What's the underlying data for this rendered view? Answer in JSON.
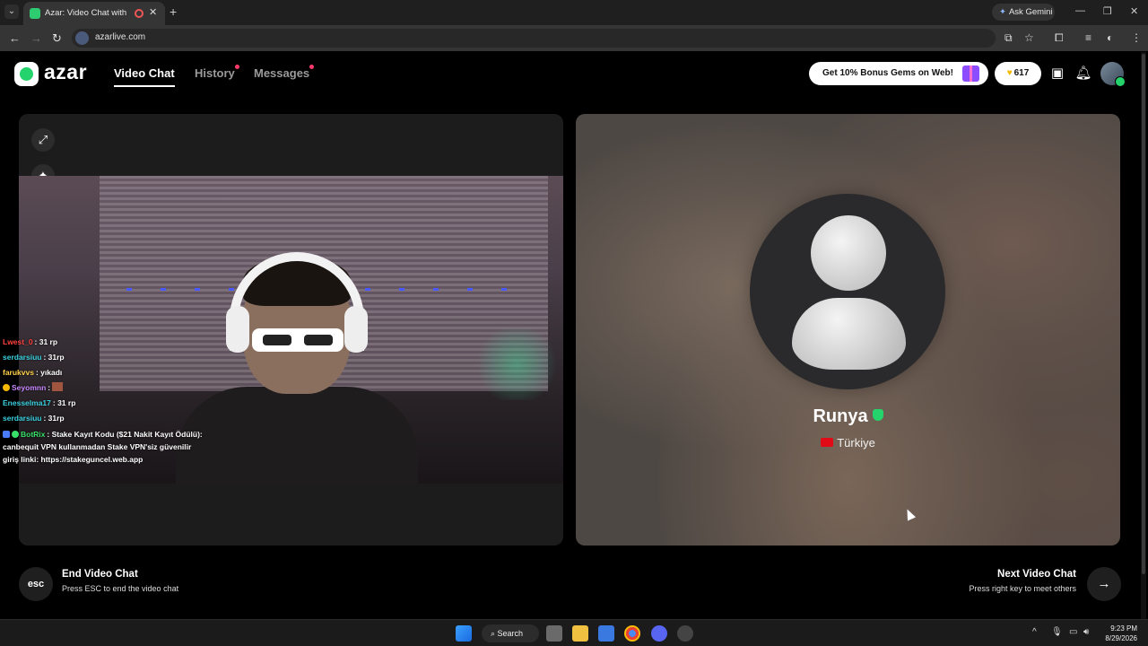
{
  "browser": {
    "tab_title": "Azar: Video Chat with New",
    "gemini_label": "Ask Gemini",
    "url": "azarlive.com"
  },
  "header": {
    "logo_text": "azar",
    "nav": [
      {
        "label": "Video Chat",
        "active": true,
        "dot": false
      },
      {
        "label": "History",
        "active": false,
        "dot": true
      },
      {
        "label": "Messages",
        "active": false,
        "dot": true
      }
    ],
    "promo_label": "Get 10% Bonus Gems on Web!",
    "gems_count": "617"
  },
  "chat_overlay": [
    {
      "user": "Lwest_0",
      "user_color": "#ff4040",
      "message": ": 31 rp"
    },
    {
      "user": "serdarsiuu",
      "user_color": "#3ad1e0",
      "message": ": 31rp"
    },
    {
      "user": "farukvvs",
      "user_color": "#ffd24a",
      "message": ": yıkadı"
    },
    {
      "user": "Seyomnn",
      "user_color": "#c98aff",
      "message": ":"
    },
    {
      "user": "Enesselma17",
      "user_color": "#3ad1e0",
      "message": ": 31 rp"
    },
    {
      "user": "serdarsiuu",
      "user_color": "#3ad1e0",
      "message": ": 31rp"
    },
    {
      "user": "BotRix",
      "user_color": "#38e06a",
      "message": ": Stake Kayıt Kodu ($21 Nakit Kayıt Ödülü): canbequit VPN kullanmadan Stake VPN'siz güvenilir giriş linki: https://stakeguncel.web.app"
    }
  ],
  "partner": {
    "name": "Runya",
    "country": "Türkiye"
  },
  "bottom": {
    "esc_label": "esc",
    "end_title": "End Video Chat",
    "end_sub": "Press ESC to end the video chat",
    "next_title": "Next Video Chat",
    "next_sub": "Press right key to meet others"
  },
  "taskbar": {
    "search_label": "Search",
    "time": "9:23 PM",
    "date": "8/29/2026"
  },
  "colors": {
    "accent_green": "#24d36b",
    "notification_dot": "#ff3a6b"
  }
}
